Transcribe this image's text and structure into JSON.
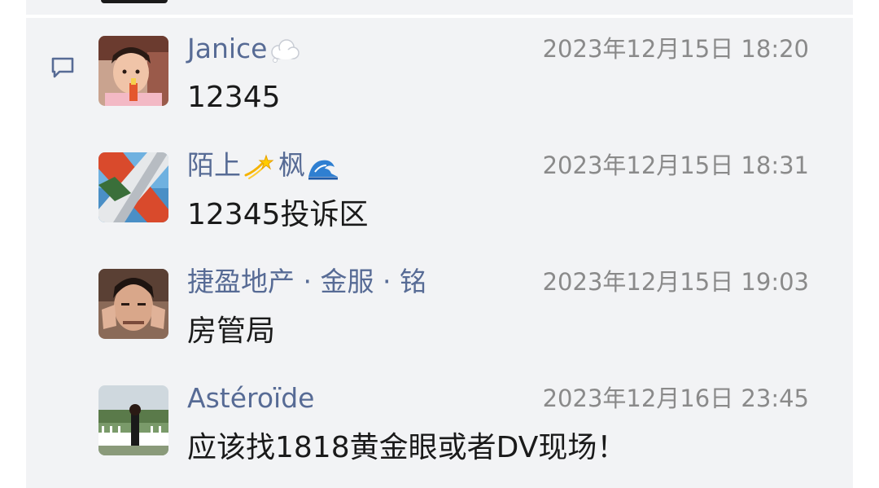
{
  "comments": [
    {
      "author": "Janice",
      "author_emoji": "thought-bubble",
      "time": "2023年12月15日 18:20",
      "text": "12345"
    },
    {
      "author_parts": [
        "陌上",
        "枫"
      ],
      "author_emojis": [
        "dizzy",
        "wave"
      ],
      "time": "2023年12月15日 18:31",
      "text": "12345投诉区"
    },
    {
      "author": "捷盈地产 · 金服 · 铭",
      "time": "2023年12月15日 19:03",
      "text": "房管局"
    },
    {
      "author": "Astéroïde",
      "time": "2023年12月16日 23:45",
      "text": "应该找1818黄金眼或者DV现场！"
    }
  ],
  "colors": {
    "panel_bg": "#f2f3f5",
    "username": "#576b95",
    "timestamp": "#8a8a8a",
    "message": "#1a1a1a"
  },
  "icons": [
    "comment-icon"
  ]
}
